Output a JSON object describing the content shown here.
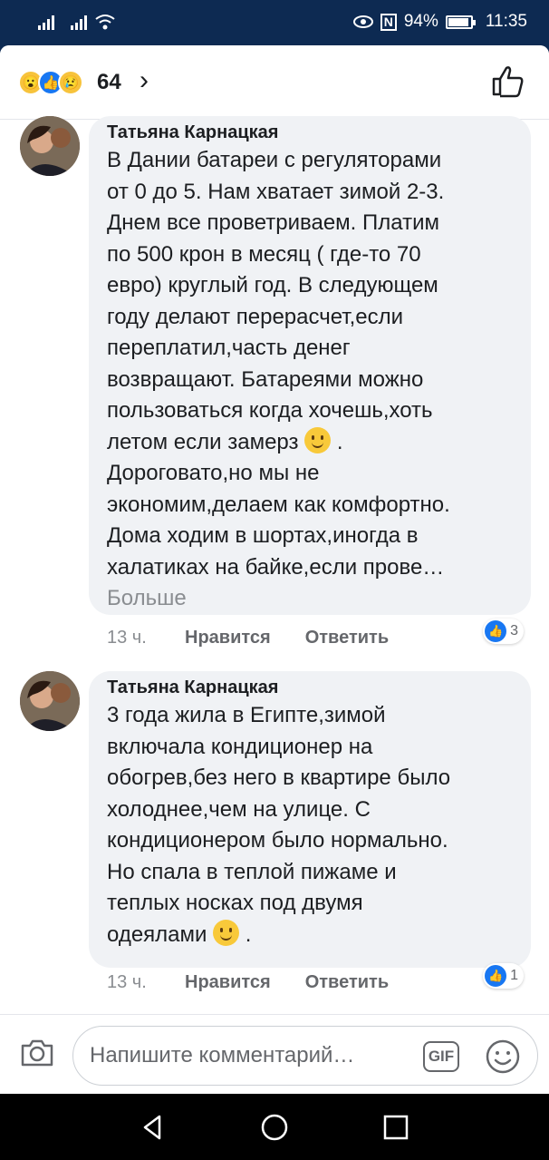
{
  "status_bar": {
    "battery_percent": "94%",
    "time": "11:35",
    "nfc_label": "N"
  },
  "reactions": {
    "count": "64",
    "icons": [
      "wow-icon",
      "like-icon",
      "sad-icon"
    ]
  },
  "comments": [
    {
      "author": "Татьяна Карнацкая",
      "lines": [
        "В Дании батареи с регуляторами",
        "от 0 до 5. Нам хватает зимой 2-3.",
        "Днем все проветриваем. Платим",
        "по 500 крон в месяц ( где-то 70",
        "евро) круглый год. В следующем",
        "году делают перерасчет,если",
        "переплатил,часть денег",
        "возвращают. Батареями можно",
        "пользоваться когда хочешь,хоть",
        "летом если замерз",
        "Дороговато,но мы не",
        "экономим,делаем как комфортно.",
        "Дома ходим в шортах,иногда в",
        "халатиках на байке,если прове…"
      ],
      "emoji_line_suffix": " .",
      "more_label": "Больше",
      "time": "13 ч.",
      "like_label": "Нравится",
      "reply_label": "Ответить",
      "like_count": "3"
    },
    {
      "author": "Татьяна Карнацкая",
      "lines": [
        "3 года жила в Египте,зимой",
        "включала кондиционер на",
        "обогрев,без него в квартире было",
        "холоднее,чем на улице. С",
        "кондиционером было нормально.",
        "Но спала в теплой пижаме и",
        "теплых носках под двумя",
        "одеялами"
      ],
      "emoji_line_suffix": " .",
      "time": "13 ч.",
      "like_label": "Нравится",
      "reply_label": "Ответить",
      "like_count": "1"
    }
  ],
  "composer": {
    "placeholder": "Напишите комментарий…",
    "gif_label": "GIF"
  },
  "colors": {
    "accent": "#1877f2",
    "bubble": "#f0f2f5",
    "status_bar": "#0d2a52"
  }
}
